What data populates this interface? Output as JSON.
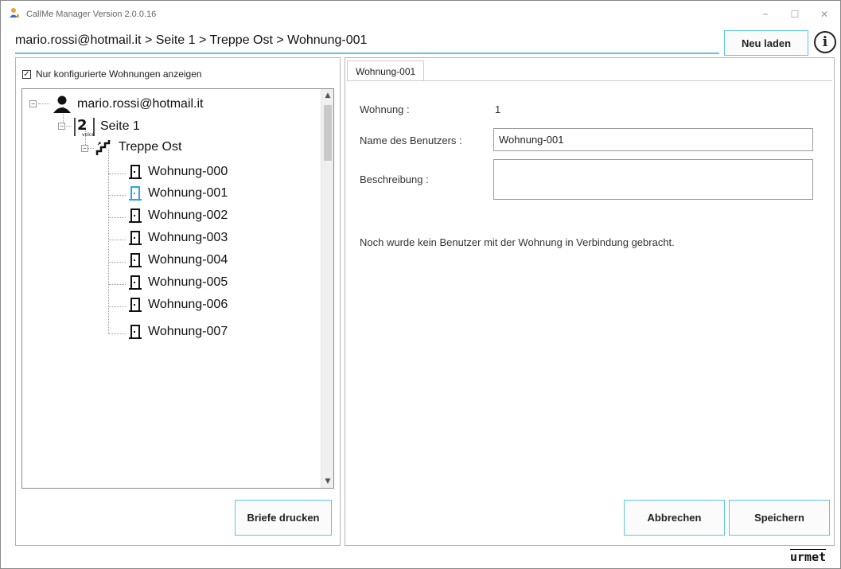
{
  "window": {
    "title": "CallMe Manager Version 2.0.0.16",
    "minimize": "–",
    "maximize": "☐",
    "close": "✕"
  },
  "breadcrumb": "mario.rossi@hotmail.it > Seite 1 > Treppe Ost > Wohnung-001",
  "toolbar": {
    "reload_label": "Neu laden",
    "info_label": "i"
  },
  "left": {
    "filter_checkbox_label": "Nur konfigurierte Wohnungen anzeigen",
    "filter_checked": true,
    "print_button": "Briefe drucken",
    "tree": {
      "root": "mario.rossi@hotmail.it",
      "page": "Seite 1",
      "staircase": "Treppe Ost",
      "apartments": [
        "Wohnung-000",
        "Wohnung-001",
        "Wohnung-002",
        "Wohnung-003",
        "Wohnung-004",
        "Wohnung-005",
        "Wohnung-006",
        "Wohnung-007"
      ],
      "selected_index": 1
    }
  },
  "right": {
    "tab_label": "Wohnung-001",
    "apartment_label": "Wohnung :",
    "apartment_value": "1",
    "username_label": "Name des Benutzers :",
    "username_value": "Wohnung-001",
    "description_label": "Beschreibung :",
    "description_value": "",
    "info_message": "Noch wurde kein Benutzer mit der Wohnung in Verbindung gebracht.",
    "cancel_button": "Abbrechen",
    "save_button": "Speichern"
  },
  "brand": "urmet",
  "colors": {
    "accent": "#5cc9d3",
    "selected_icon": "#29a9e0"
  }
}
